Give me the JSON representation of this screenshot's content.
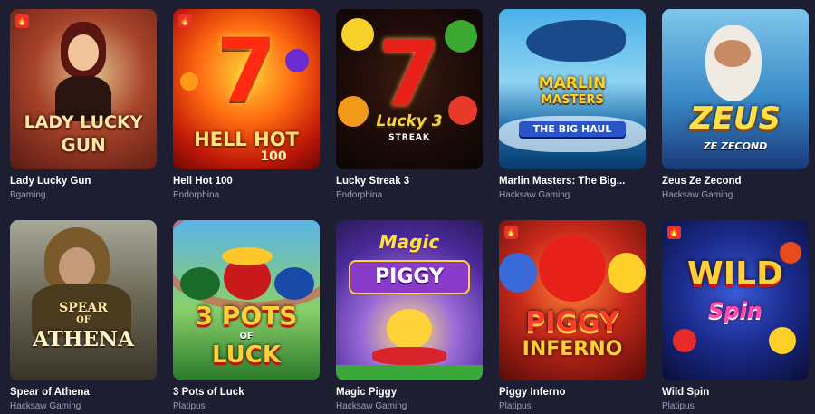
{
  "games": [
    {
      "title": "Lady Lucky Gun",
      "provider": "Bgaming",
      "hot": true,
      "logo_lines": [
        "LADY LUCKY",
        "GUN"
      ]
    },
    {
      "title": "Hell Hot 100",
      "provider": "Endorphina",
      "hot": true,
      "logo_lines": [
        "HELL HOT",
        "100"
      ]
    },
    {
      "title": "Lucky Streak 3",
      "provider": "Endorphina",
      "hot": false,
      "logo_lines": [
        "Lucky 3",
        "STREAK"
      ]
    },
    {
      "title": "Marlin Masters: The Big...",
      "provider": "Hacksaw Gaming",
      "hot": false,
      "logo_lines": [
        "MARLIN",
        "MASTERS",
        "THE BIG HAUL"
      ]
    },
    {
      "title": "Zeus Ze Zecond",
      "provider": "Hacksaw Gaming",
      "hot": false,
      "logo_lines": [
        "ZEUS",
        "ZE ZECOND"
      ]
    },
    {
      "title": "Spear of Athena",
      "provider": "Hacksaw Gaming",
      "hot": false,
      "logo_lines": [
        "SPEAR",
        "OF",
        "ATHENA"
      ]
    },
    {
      "title": "3 Pots of Luck",
      "provider": "Platipus",
      "hot": false,
      "logo_lines": [
        "3 POTS",
        "OF",
        "LUCK"
      ]
    },
    {
      "title": "Magic Piggy",
      "provider": "Hacksaw Gaming",
      "hot": false,
      "logo_lines": [
        "Magic",
        "PIGGY"
      ]
    },
    {
      "title": "Piggy Inferno",
      "provider": "Platipus",
      "hot": true,
      "logo_lines": [
        "PIGGY",
        "INFERNO"
      ]
    },
    {
      "title": "Wild Spin",
      "provider": "Platipus",
      "hot": true,
      "logo_lines": [
        "WILD",
        "Spin"
      ]
    }
  ],
  "icons": {
    "hot_badge": "fire-icon"
  },
  "colors": {
    "page_background": "#1d1e31",
    "hot_badge": "#e8312a",
    "title": "#ffffff",
    "provider": "#9aa0b8"
  }
}
